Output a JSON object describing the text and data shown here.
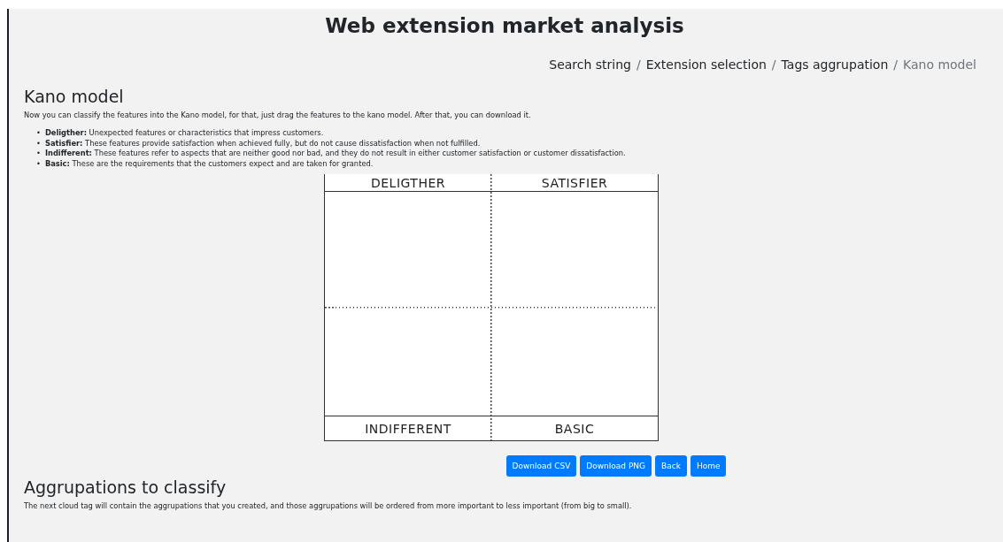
{
  "page_title": "Web extension market analysis",
  "breadcrumb": [
    {
      "label": "Search string",
      "selected": false
    },
    {
      "separator": "/",
      "label": "Extension selection",
      "selected": false
    },
    {
      "separator": "/",
      "label": "Tags aggrupation",
      "selected": false
    },
    {
      "separator": "/",
      "label": "Kano model",
      "selected": true
    }
  ],
  "kano_section": {
    "heading": "Kano model",
    "intro": "Now you can classify the features into the Kano model, for that, just drag the features to the kano model. After that, you can download it.",
    "definitions": [
      {
        "marker": "•",
        "text": "**Deligther:** Unexpected features or characteristics that impress customers."
      },
      {
        "marker": "•",
        "text": "**Satisfier:** These features provide satisfaction when achieved fully, but do not cause dissatisfaction when not fulfilled."
      },
      {
        "marker": "•",
        "text": "**Indifferent:** These features refer to aspects that are neither good nor bad, and they do not result in either customer satisfaction or customer dissatisfaction."
      },
      {
        "marker": "•",
        "text": "**Basic:** These are the requirements that the customers expect and are taken for granted."
      }
    ],
    "kano_board": {
      "top_labels": [
        "DELIGTHER",
        "SATISFIER"
      ],
      "bottom_labels": [
        "INDIFFERENT",
        "BASIC"
      ]
    }
  },
  "buttons": [
    "Download CSV",
    "Download PNG",
    "Back",
    "Home"
  ],
  "aggrupations_section": {
    "heading": "Aggrupations to classify",
    "text": "The next cloud tag will contain the aggrupations that you created, and those aggrupations will be ordered from more important to less important (from big to small)."
  }
}
